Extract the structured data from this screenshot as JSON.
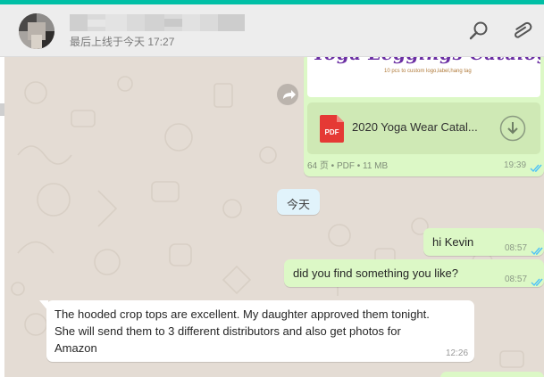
{
  "header": {
    "last_seen": "最后上线于今天 17:27",
    "search_icon": "search-icon",
    "attach_icon": "paperclip-icon"
  },
  "document_message": {
    "preview_title": "Yoga Leggings Catalog",
    "preview_subtitle": "10 pcs to custom logo,label,hang tag",
    "file_type_badge": "PDF",
    "file_name": "2020 Yoga Wear Catal...",
    "meta": "64 页 • PDF • 11 MB",
    "time": "19:39",
    "status": "read"
  },
  "date_divider": "今天",
  "messages": [
    {
      "direction": "out",
      "text": "hi Kevin",
      "time": "08:57",
      "status": "read"
    },
    {
      "direction": "out",
      "text": "did you find something you like?",
      "time": "08:57",
      "status": "read"
    },
    {
      "direction": "in",
      "lines": [
        "The hooded crop tops are excellent. My daughter approved them tonight.",
        "She will send them to 3 different distributors and also get photos for",
        "Amazon"
      ],
      "time": "12:26"
    }
  ],
  "colors": {
    "accent": "#00bfa5",
    "outgoing_bubble": "#dcf8c6",
    "incoming_bubble": "#ffffff",
    "chat_background": "#e4dcd4",
    "date_chip": "#e1f3fb",
    "read_ticks": "#4fc3f7",
    "pdf_badge": "#e53935"
  }
}
